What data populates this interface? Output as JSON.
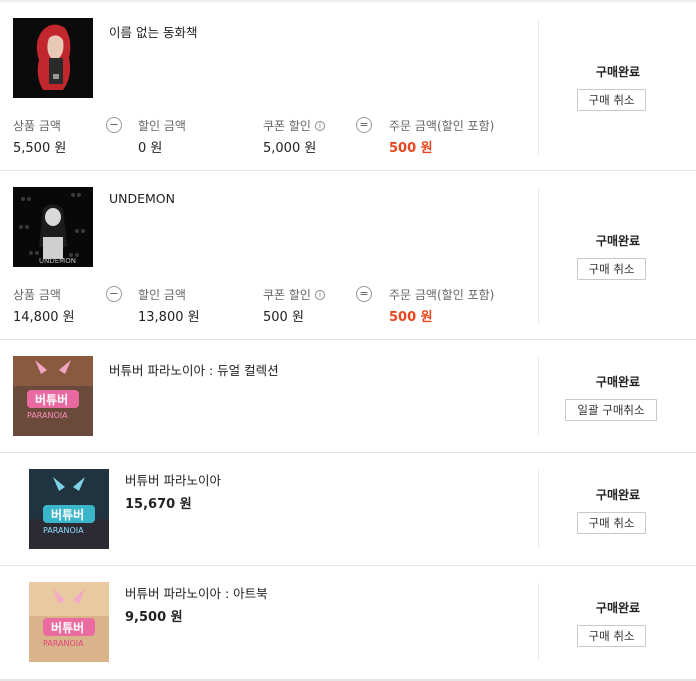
{
  "orders": [
    {
      "title": "이름 없는 동화책",
      "status": "구매완료",
      "action": "구매 취소",
      "summary": {
        "product_label": "상품 금액",
        "product_value": "5,500 원",
        "discount_label": "할인 금액",
        "discount_value": "0 원",
        "coupon_label": "쿠폰 할인",
        "coupon_value": "5,000 원",
        "total_label": "주문 금액(할인 포함)",
        "total_value": "500 원",
        "minus": "−",
        "equals": "=",
        "info": "i"
      }
    },
    {
      "title": "UNDEMON",
      "status": "구매완료",
      "action": "구매 취소",
      "summary": {
        "product_label": "상품 금액",
        "product_value": "14,800 원",
        "discount_label": "할인 금액",
        "discount_value": "13,800 원",
        "coupon_label": "쿠폰 할인",
        "coupon_value": "500 원",
        "total_label": "주문 금액(할인 포함)",
        "total_value": "500 원",
        "minus": "−",
        "equals": "=",
        "info": "i"
      }
    },
    {
      "title": "버튜버 파라노이아 : 듀얼 컬렉션",
      "status": "구매완료",
      "action": "일괄 구매취소"
    },
    {
      "title": "버튜버 파라노이아",
      "price": "15,670 원",
      "status": "구매완료",
      "action": "구매 취소"
    },
    {
      "title": "버튜버 파라노이아 : 아트북",
      "price": "9,500 원",
      "status": "구매완료",
      "action": "구매 취소"
    }
  ],
  "colors": {
    "accent": "#e8461e",
    "border": "#e6e6e6"
  }
}
